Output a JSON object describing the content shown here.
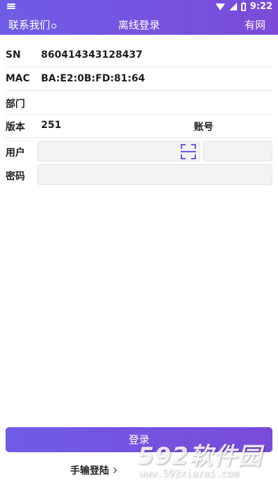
{
  "status_bar": {
    "time": "9:22",
    "icons": [
      "notification-icon",
      "wifi-icon",
      "signal-icon",
      "battery-icon"
    ]
  },
  "title_bar": {
    "left_label": "联系我们",
    "title": "离线登录",
    "right_label": "有网"
  },
  "info": {
    "sn_label": "SN",
    "sn_value": "860414343128437",
    "mac_label": "MAC",
    "mac_value": "BA:E2:0B:FD:81:64",
    "dept_label": "部门",
    "dept_value": "",
    "version_label": "版本",
    "version_value": "251",
    "account_label": "账号"
  },
  "form": {
    "user_label": "用户",
    "user_value": "",
    "account_value": "",
    "password_label": "密码",
    "password_value": ""
  },
  "login_button": "登录",
  "manual_login": "手输登陆",
  "watermark": {
    "big": "592软件园",
    "small": "www.592xiazai.com"
  },
  "colors": {
    "accent": "#6f5ce6",
    "accent_end": "#7a4bd9"
  }
}
